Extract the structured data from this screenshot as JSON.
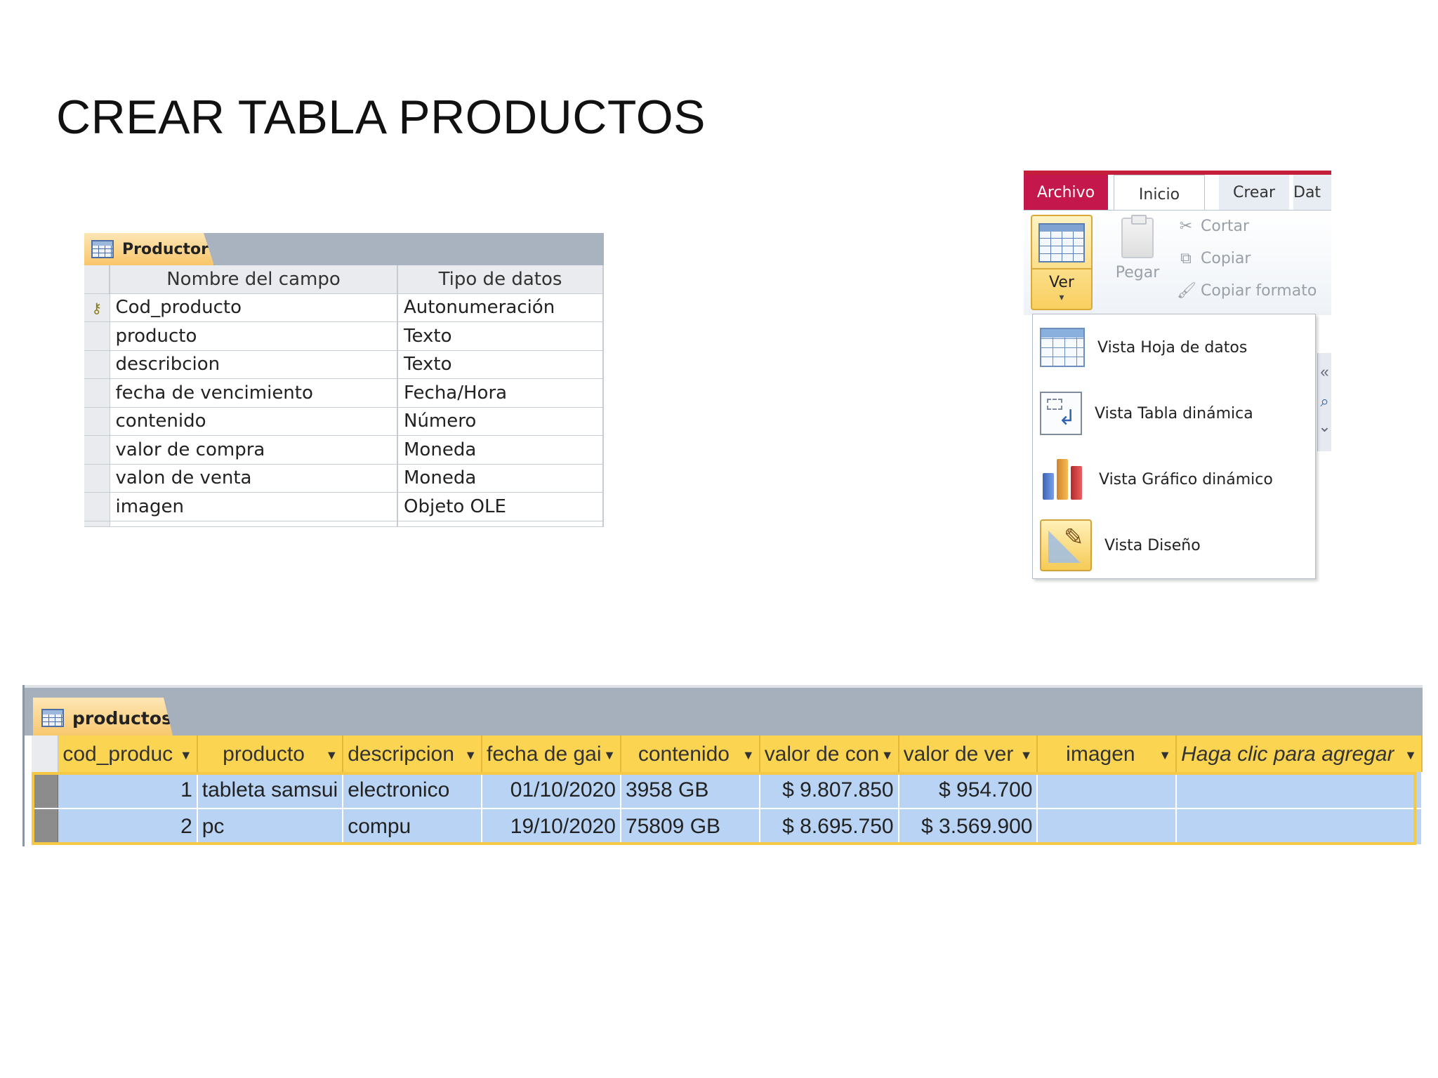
{
  "slide": {
    "title": "CREAR TABLA PRODUCTOS"
  },
  "design_view": {
    "tab_label": "Productor",
    "columns": [
      "Nombre del campo",
      "Tipo de datos"
    ],
    "rows": [
      {
        "field": "Cod_producto",
        "type": "Autonumeración",
        "primary_key": true
      },
      {
        "field": "producto",
        "type": "Texto"
      },
      {
        "field": "describcion",
        "type": "Texto"
      },
      {
        "field": "fecha de vencimiento",
        "type": "Fecha/Hora"
      },
      {
        "field": "contenido",
        "type": "Número"
      },
      {
        "field": "valor de compra",
        "type": "Moneda"
      },
      {
        "field": "valon de venta",
        "type": "Moneda"
      },
      {
        "field": "imagen",
        "type": "Objeto OLE"
      }
    ]
  },
  "ribbon": {
    "tabs": {
      "archivo": "Archivo",
      "inicio": "Inicio",
      "crear": "Crear",
      "datos": "Dat"
    },
    "ver_label": "Ver",
    "pegar_label": "Pegar",
    "cortar_label": "Cortar",
    "copiar_label": "Copiar",
    "copiar_formato_label": "Copiar formato",
    "menu_items": [
      "Vista Hoja de datos",
      "Vista Tabla dinámica",
      "Vista Gráfico dinámico",
      "Vista Diseño"
    ],
    "side_glyphs": [
      "«",
      "⌕",
      "⌄"
    ]
  },
  "datasheet": {
    "tab_label": "productos",
    "columns": [
      "cod_produc",
      "producto",
      "descripcion",
      "fecha de gai",
      "contenido",
      "valor de con",
      "valor de ver",
      "imagen",
      "Haga clic para agregar"
    ],
    "rows": [
      [
        "1",
        "tableta samsui",
        "electronico",
        "01/10/2020",
        "3958 GB",
        "$ 9.807.850",
        "$ 954.700",
        "",
        ""
      ],
      [
        "2",
        "pc",
        "compu",
        "19/10/2020",
        "75809 GB",
        "$ 8.695.750",
        "$ 3.569.900",
        "",
        ""
      ]
    ]
  },
  "colors": {
    "archivo_tab": "#c4174b",
    "header_yellow": "#fbd451",
    "selected_row_blue": "#b8d3f3",
    "tab_gray": "#a6b0bc"
  }
}
